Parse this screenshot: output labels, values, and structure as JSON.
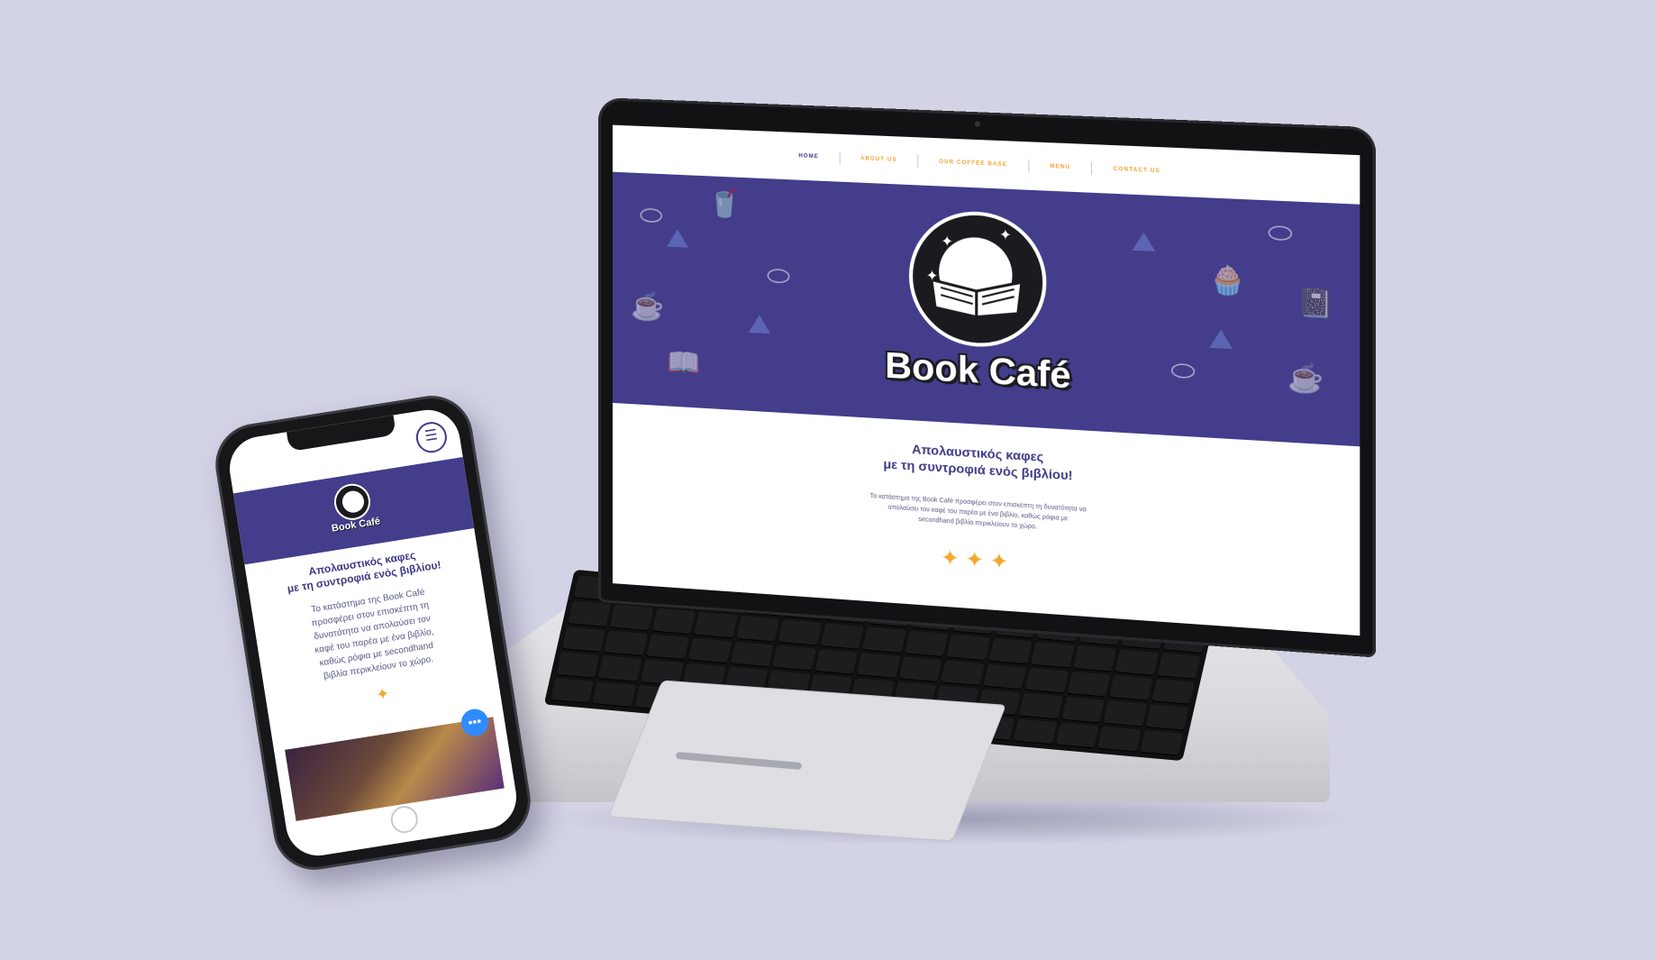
{
  "colors": {
    "background": "#d3d3e6",
    "hero": "#433d8b",
    "accent_orange": "#f2a12c",
    "navy_text": "#3c3a86",
    "chat_blue": "#2f8cff"
  },
  "laptop": {
    "nav": [
      {
        "label": "HOME",
        "active": true
      },
      {
        "label": "ABOUT US",
        "active": false
      },
      {
        "label": "OUR COFFEE BASE",
        "active": false
      },
      {
        "label": "MENU",
        "active": false
      },
      {
        "label": "CONTACT US",
        "active": false
      }
    ],
    "brand": "Book Café",
    "headline_line1": "Απολαυστικός καφες",
    "headline_line2": "με τη συντροφιά ενός βιβλίου!",
    "body": "Το κατάστημα της Book Café προσφέρει στον επισκέπτη τη δυνατότητα να απολαύσει τον καφέ του παρέα με ένα βιβλίο, καθώς ρόφια με secondhand βιβλία περικλείουν το χώρο.",
    "stars": "✦✦✦"
  },
  "phone": {
    "brand": "Book Café",
    "headline_line1": "Απολαυστικός καφες",
    "headline_line2": "με τη συντροφιά ενός βιβλίου!",
    "body": "Το κατάστημα της Book Café προσφέρει στον επισκέπτη τη δυνατότητα να απολαύσει τον καφέ του παρέα με ένα βιβλίο, καθώς ρόφια με secondhand βιβλία περικλείουν το χώρο.",
    "star": "✦",
    "menu_icon": "☰",
    "chat_icon": "•••"
  }
}
